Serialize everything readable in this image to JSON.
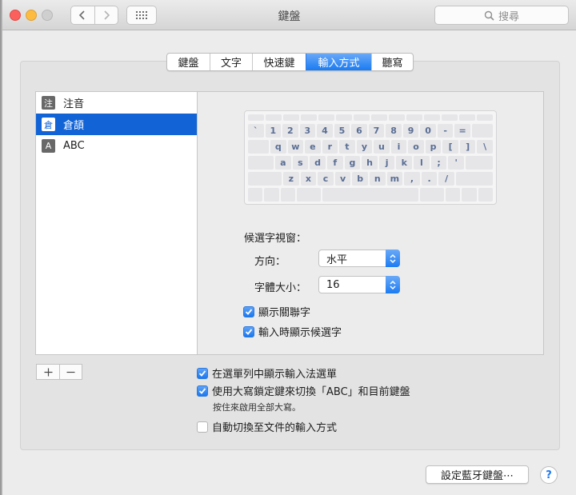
{
  "window": {
    "title": "鍵盤"
  },
  "toolbar": {
    "search_placeholder": "搜尋"
  },
  "tabs": [
    {
      "label": "鍵盤",
      "active": false
    },
    {
      "label": "文字",
      "active": false
    },
    {
      "label": "快速鍵",
      "active": false
    },
    {
      "label": "輸入方式",
      "active": true
    },
    {
      "label": "聽寫",
      "active": false
    }
  ],
  "input_sources": [
    {
      "icon_char": "注",
      "label": "注音",
      "selected": false
    },
    {
      "icon_char": "倉",
      "label": "倉頡",
      "selected": true
    },
    {
      "icon_char": "A",
      "label": "ABC",
      "selected": false
    }
  ],
  "keyboard": {
    "row1": [
      "`",
      "1",
      "2",
      "3",
      "4",
      "5",
      "6",
      "7",
      "8",
      "9",
      "0",
      "-",
      "="
    ],
    "row2": [
      "q",
      "w",
      "e",
      "r",
      "t",
      "y",
      "u",
      "i",
      "o",
      "p",
      "[",
      "]",
      "\\"
    ],
    "row3": [
      "a",
      "s",
      "d",
      "f",
      "g",
      "h",
      "j",
      "k",
      "l",
      ";",
      "'"
    ],
    "row4": [
      "z",
      "x",
      "c",
      "v",
      "b",
      "n",
      "m",
      ",",
      ".",
      "/"
    ]
  },
  "candidate_window": {
    "label": "候選字視窗：",
    "orientation_label": "方向：",
    "orientation_value": "水平",
    "font_size_label": "字體大小：",
    "font_size_value": "16"
  },
  "options": {
    "show_associated": {
      "label": "顯示關聯字",
      "checked": true
    },
    "show_candidates_while_typing": {
      "label": "輸入時顯示候選字",
      "checked": true
    },
    "show_in_menu_bar": {
      "label": "在選單列中顯示輸入法選單",
      "checked": true
    },
    "caps_lock_switch": {
      "label": "使用大寫鎖定鍵來切換「ABC」和目前鍵盤",
      "checked": true
    },
    "caps_lock_note": "按住來啟用全部大寫。",
    "auto_switch": {
      "label": "自動切換至文件的輸入方式",
      "checked": false
    }
  },
  "list_controls": {
    "add": "+",
    "remove": "−"
  },
  "footer": {
    "bluetooth_button": "設定藍牙鍵盤⋯",
    "help": "?"
  },
  "colors": {
    "accent": "#1a78f0",
    "selection": "#1163d6",
    "key_text": "#5a6e93"
  }
}
